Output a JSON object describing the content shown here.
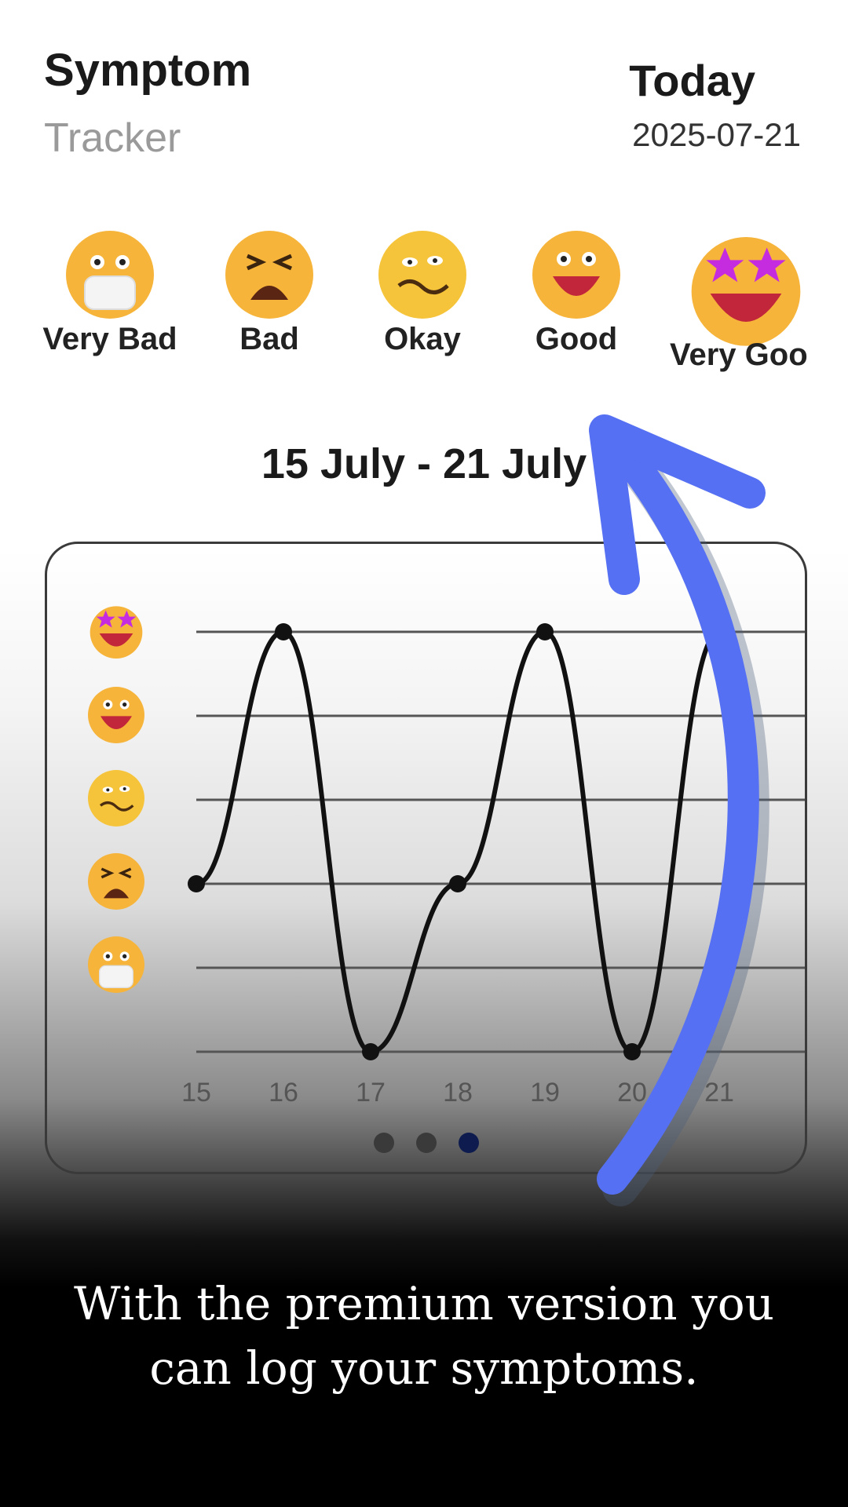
{
  "header": {
    "title": "Symptom",
    "subtitle": "Tracker",
    "today_label": "Today",
    "date": "2025-07-21"
  },
  "moods": [
    {
      "label": "Very Bad",
      "icon": "mask-face-icon"
    },
    {
      "label": "Bad",
      "icon": "tired-face-icon"
    },
    {
      "label": "Okay",
      "icon": "woozy-face-icon"
    },
    {
      "label": "Good",
      "icon": "smile-face-icon"
    },
    {
      "label": "Very Goo",
      "icon": "star-struck-face-icon"
    }
  ],
  "week_range": "15 July - 21 July",
  "chart_data": {
    "type": "line",
    "x": [
      "15",
      "16",
      "17",
      "18",
      "19",
      "20",
      "21"
    ],
    "series": [
      {
        "values": [
          2,
          5,
          0,
          2,
          5,
          0,
          5
        ]
      }
    ],
    "y_levels": [
      "Very Good",
      "Good",
      "Okay",
      "Bad",
      "Very Bad"
    ],
    "ylim": [
      0,
      5
    ],
    "grid": true
  },
  "pagination": {
    "count": 3,
    "active": 3
  },
  "caption": "With the premium version you can log your symptoms.",
  "colors": {
    "arrow": "#5570f2",
    "active_dot": "#0d1b4f",
    "inactive_dot": "#3a3a3a"
  }
}
